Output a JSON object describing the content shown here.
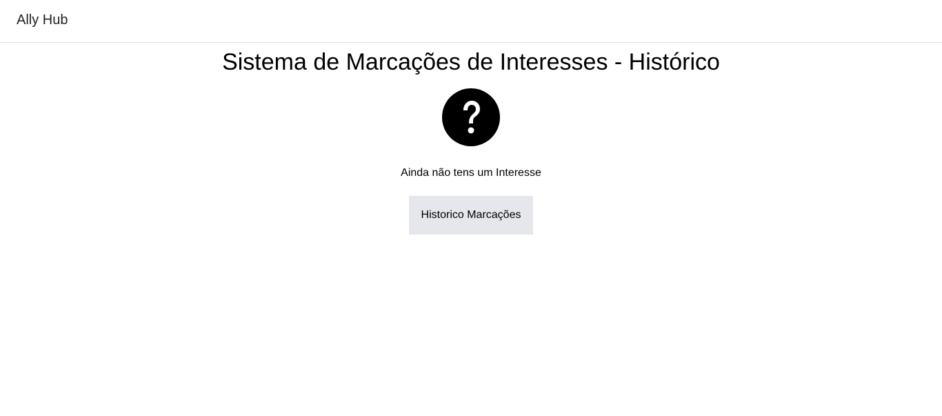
{
  "header": {
    "brand": "Ally Hub"
  },
  "main": {
    "title": "Sistema de Marcações de Interesses - Histórico",
    "icon": "help-circle-icon",
    "empty_message": "Ainda não tens um Interesse",
    "history_button_label": "Historico Marcações"
  },
  "colors": {
    "button_bg": "#e6e7eb",
    "divider": "#e0e0e0",
    "text": "#000000"
  }
}
